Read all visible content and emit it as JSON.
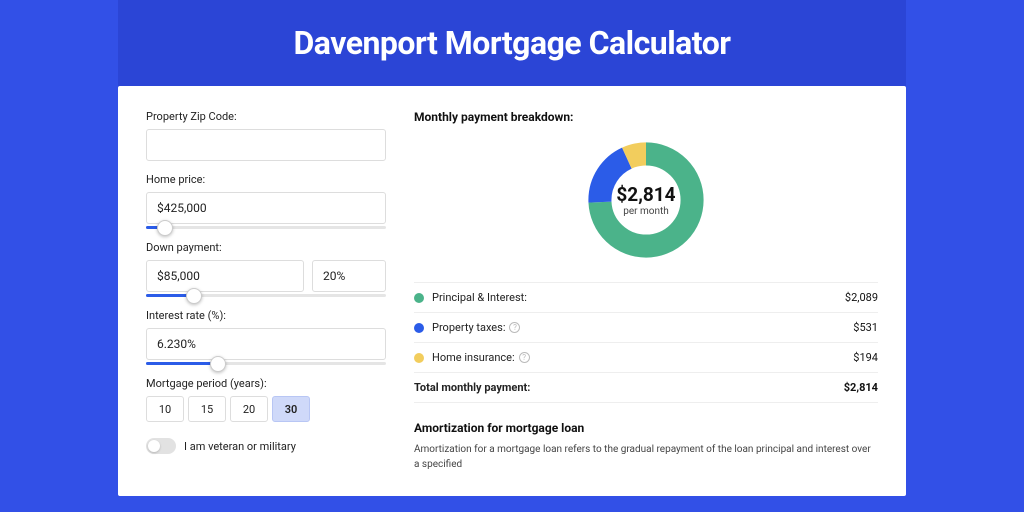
{
  "title": "Davenport Mortgage Calculator",
  "form": {
    "zip_label": "Property Zip Code:",
    "zip_value": "",
    "home_price_label": "Home price:",
    "home_price_value": "$425,000",
    "home_price_slider_pct": 8,
    "down_label": "Down payment:",
    "down_value": "$85,000",
    "down_pct": "20%",
    "down_slider_pct": 20,
    "rate_label": "Interest rate (%):",
    "rate_value": "6.230%",
    "rate_slider_pct": 30,
    "period_label": "Mortgage period (years):",
    "periods": [
      "10",
      "15",
      "20",
      "30"
    ],
    "period_selected": "30",
    "veteran_label": "I am veteran or military"
  },
  "breakdown": {
    "heading": "Monthly payment breakdown:",
    "center_amount": "$2,814",
    "center_sub": "per month",
    "items": [
      {
        "key": "pi",
        "label": "Principal & Interest:",
        "value": "$2,089",
        "color": "#4bb38a"
      },
      {
        "key": "tax",
        "label": "Property taxes:",
        "value": "$531",
        "color": "#2b5ce8",
        "info": true
      },
      {
        "key": "ins",
        "label": "Home insurance:",
        "value": "$194",
        "color": "#f2cd5d",
        "info": true
      }
    ],
    "total_label": "Total monthly payment:",
    "total_value": "$2,814"
  },
  "amort": {
    "heading": "Amortization for mortgage loan",
    "body": "Amortization for a mortgage loan refers to the gradual repayment of the loan principal and interest over a specified"
  },
  "chart_data": {
    "type": "pie",
    "title": "Monthly payment breakdown",
    "series": [
      {
        "name": "Principal & Interest",
        "value": 2089,
        "color": "#4bb38a"
      },
      {
        "name": "Property taxes",
        "value": 531,
        "color": "#2b5ce8"
      },
      {
        "name": "Home insurance",
        "value": 194,
        "color": "#f2cd5d"
      }
    ],
    "total": 2814,
    "center_label": "$2,814 per month"
  }
}
